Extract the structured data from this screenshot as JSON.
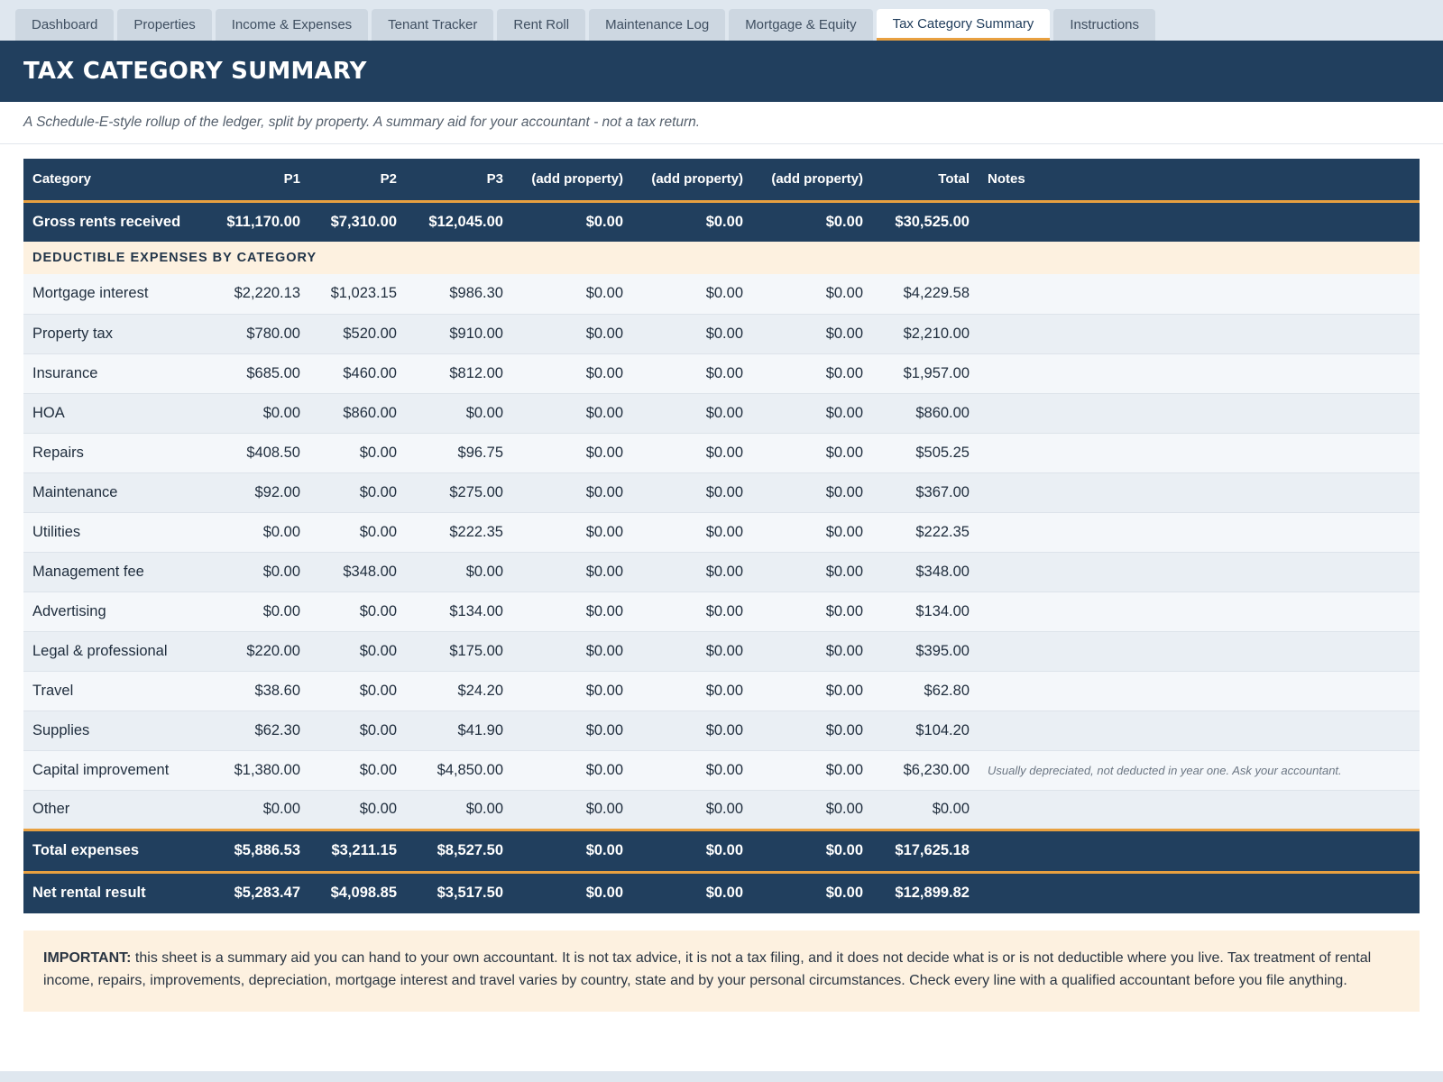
{
  "tabs": [
    {
      "label": "Dashboard",
      "active": false
    },
    {
      "label": "Properties",
      "active": false
    },
    {
      "label": "Income & Expenses",
      "active": false
    },
    {
      "label": "Tenant Tracker",
      "active": false
    },
    {
      "label": "Rent Roll",
      "active": false
    },
    {
      "label": "Maintenance Log",
      "active": false
    },
    {
      "label": "Mortgage & Equity",
      "active": false
    },
    {
      "label": "Tax Category Summary",
      "active": true
    },
    {
      "label": "Instructions",
      "active": false
    }
  ],
  "page": {
    "title": "TAX CATEGORY SUMMARY",
    "subtitle": "A Schedule-E-style rollup of the ledger, split by property. A summary aid for your accountant - not a tax return."
  },
  "table": {
    "columns": [
      "Category",
      "P1",
      "P2",
      "P3",
      "(add property)",
      "(add property)",
      "(add property)",
      "Total",
      "Notes"
    ],
    "gross": {
      "label": "Gross rents received",
      "values": [
        "$11,170.00",
        "$7,310.00",
        "$12,045.00",
        "$0.00",
        "$0.00",
        "$0.00",
        "$30,525.00"
      ],
      "note": ""
    },
    "section_label": "DEDUCTIBLE EXPENSES BY CATEGORY",
    "rows": [
      {
        "label": "Mortgage interest",
        "values": [
          "$2,220.13",
          "$1,023.15",
          "$986.30",
          "$0.00",
          "$0.00",
          "$0.00",
          "$4,229.58"
        ],
        "note": ""
      },
      {
        "label": "Property tax",
        "values": [
          "$780.00",
          "$520.00",
          "$910.00",
          "$0.00",
          "$0.00",
          "$0.00",
          "$2,210.00"
        ],
        "note": ""
      },
      {
        "label": "Insurance",
        "values": [
          "$685.00",
          "$460.00",
          "$812.00",
          "$0.00",
          "$0.00",
          "$0.00",
          "$1,957.00"
        ],
        "note": ""
      },
      {
        "label": "HOA",
        "values": [
          "$0.00",
          "$860.00",
          "$0.00",
          "$0.00",
          "$0.00",
          "$0.00",
          "$860.00"
        ],
        "note": ""
      },
      {
        "label": "Repairs",
        "values": [
          "$408.50",
          "$0.00",
          "$96.75",
          "$0.00",
          "$0.00",
          "$0.00",
          "$505.25"
        ],
        "note": ""
      },
      {
        "label": "Maintenance",
        "values": [
          "$92.00",
          "$0.00",
          "$275.00",
          "$0.00",
          "$0.00",
          "$0.00",
          "$367.00"
        ],
        "note": ""
      },
      {
        "label": "Utilities",
        "values": [
          "$0.00",
          "$0.00",
          "$222.35",
          "$0.00",
          "$0.00",
          "$0.00",
          "$222.35"
        ],
        "note": ""
      },
      {
        "label": "Management fee",
        "values": [
          "$0.00",
          "$348.00",
          "$0.00",
          "$0.00",
          "$0.00",
          "$0.00",
          "$348.00"
        ],
        "note": ""
      },
      {
        "label": "Advertising",
        "values": [
          "$0.00",
          "$0.00",
          "$134.00",
          "$0.00",
          "$0.00",
          "$0.00",
          "$134.00"
        ],
        "note": ""
      },
      {
        "label": "Legal & professional",
        "values": [
          "$220.00",
          "$0.00",
          "$175.00",
          "$0.00",
          "$0.00",
          "$0.00",
          "$395.00"
        ],
        "note": ""
      },
      {
        "label": "Travel",
        "values": [
          "$38.60",
          "$0.00",
          "$24.20",
          "$0.00",
          "$0.00",
          "$0.00",
          "$62.80"
        ],
        "note": ""
      },
      {
        "label": "Supplies",
        "values": [
          "$62.30",
          "$0.00",
          "$41.90",
          "$0.00",
          "$0.00",
          "$0.00",
          "$104.20"
        ],
        "note": ""
      },
      {
        "label": "Capital improvement",
        "values": [
          "$1,380.00",
          "$0.00",
          "$4,850.00",
          "$0.00",
          "$0.00",
          "$0.00",
          "$6,230.00"
        ],
        "note": "Usually depreciated, not deducted in year one. Ask your accountant."
      },
      {
        "label": "Other",
        "values": [
          "$0.00",
          "$0.00",
          "$0.00",
          "$0.00",
          "$0.00",
          "$0.00",
          "$0.00"
        ],
        "note": ""
      }
    ],
    "total_expenses": {
      "label": "Total expenses",
      "values": [
        "$5,886.53",
        "$3,211.15",
        "$8,527.50",
        "$0.00",
        "$0.00",
        "$0.00",
        "$17,625.18"
      ],
      "note": ""
    },
    "net": {
      "label": "Net rental result",
      "values": [
        "$5,283.47",
        "$4,098.85",
        "$3,517.50",
        "$0.00",
        "$0.00",
        "$0.00",
        "$12,899.82"
      ],
      "note": ""
    }
  },
  "disclaimer": {
    "lead": "IMPORTANT:",
    "text": " this sheet is a summary aid you can hand to your own accountant. It is not tax advice, it is not a tax filing, and it does not decide what is or is not deductible where you live. Tax treatment of rental income, repairs, improvements, depreciation, mortgage interest and travel varies by country, state and by your personal circumstances. Check every line with a qualified accountant before you file anything."
  },
  "colors": {
    "navy": "#213f5e",
    "accent_orange": "#e8a040",
    "cream": "#fdf1e0",
    "tabbar": "#dfe7ef"
  }
}
